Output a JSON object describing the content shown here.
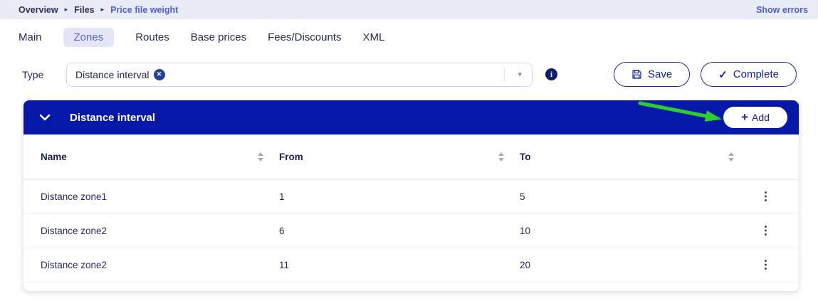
{
  "breadcrumb": {
    "items": [
      "Overview",
      "Files",
      "Price file weight"
    ],
    "separator": "▸",
    "show_errors_label": "Show errors"
  },
  "tabs": [
    {
      "label": "Main"
    },
    {
      "label": "Zones"
    },
    {
      "label": "Routes"
    },
    {
      "label": "Base prices"
    },
    {
      "label": "Fees/Discounts"
    },
    {
      "label": "XML"
    }
  ],
  "type_field": {
    "label": "Type",
    "selected_chip": "Distance interval",
    "chip_remove_glyph": "✕",
    "caret_glyph": "▾",
    "info_glyph": "i"
  },
  "toolbar": {
    "save_label": "Save",
    "complete_label": "Complete",
    "check_glyph": "✓"
  },
  "panel": {
    "title": "Distance interval",
    "add_label": "Add",
    "plus_glyph": "+"
  },
  "table": {
    "headers": [
      "Name",
      "From",
      "To"
    ],
    "kebab_glyph": "⋮",
    "rows": [
      {
        "name": "Distance zone1",
        "from": "1",
        "to": "5"
      },
      {
        "name": "Distance zone2",
        "from": "6",
        "to": "10"
      },
      {
        "name": "Distance zone2",
        "from": "11",
        "to": "20"
      }
    ]
  },
  "annotation": {
    "description": "green arrow pointing at Add button",
    "color": "#2bd12b"
  },
  "colors": {
    "panel_header_bg": "#0518a8",
    "link_blue": "#4c5ed5",
    "button_navy": "#1b2a9e",
    "breadcrumb_bg": "#e9ebf6"
  }
}
